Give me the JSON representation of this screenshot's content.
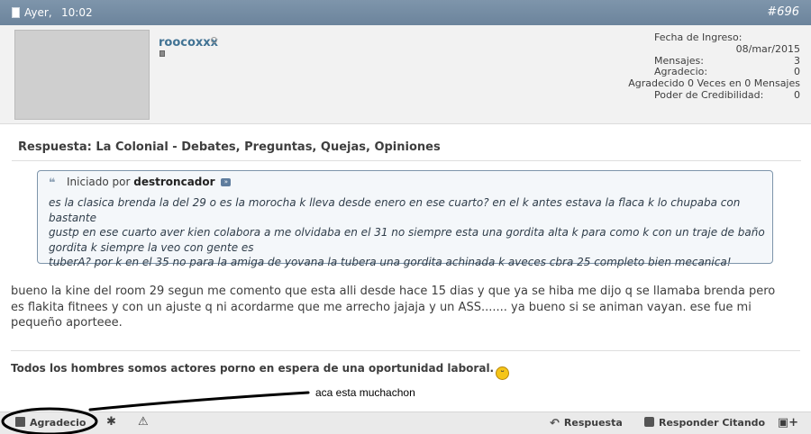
{
  "header": {
    "date": "Ayer,",
    "time": "10:02",
    "post_number": "#696"
  },
  "user": {
    "username": "roocoxxx",
    "avatar_icon": "avatar-image"
  },
  "stats": {
    "join_label": "Fecha de Ingreso:",
    "join_value": "08/mar/2015",
    "posts_label": "Mensajes:",
    "posts_value": "3",
    "thanks_label": "Agradecio:",
    "thanks_value": "0",
    "thanked_line": "Agradecido 0 Veces en 0 Mensajes",
    "cred_label": "Poder de Credibilidad:",
    "cred_value": "0"
  },
  "post": {
    "title": "Respuesta: La Colonial - Debates, Preguntas, Quejas, Opiniones",
    "quote_started_prefix": "Iniciado por",
    "quote_author": "destroncador",
    "quote_line1": "es la clasica brenda la del 29 o es la morocha k lleva desde enero en ese cuarto? en el k antes estava la flaca k lo chupaba con bastante",
    "quote_line2": "gustp en ese cuarto aver kien colabora a me olvidaba en el 31 no siempre esta una gordita alta k para como k con un traje de baño",
    "quote_line3": "gordita k siempre la veo con gente es",
    "quote_line4": "tuberA? por k en el 35 no para la amiga de yovana la tubera una gordita achinada k aveces cbra 25 completo bien mecanica!",
    "body_line1": "bueno la kine del room 29 segun me comento que esta alli desde hace 15 dias y que ya se hiba me dijo q se llamaba brenda pero",
    "body_line2": "es flakita fitnees y con un ajuste q ni acordarme que me arrecho jajaja y un ASS....... ya bueno si se animan vayan. ese fue mi",
    "body_line3": "pequeño aporteee.",
    "signature": "Todos los hombres somos actores porno en espera de una oportunidad laboral."
  },
  "annotation": {
    "text": "aca esta muchachon"
  },
  "footer": {
    "thanks_label": "Agradecio",
    "reply_label": "Respuesta",
    "quote_reply_label": "Responder Citando"
  },
  "colors": {
    "header_bg": "#7e95ab",
    "username": "#417394",
    "quote_border": "#7e95ab",
    "footer_bg": "#eaeaea"
  }
}
